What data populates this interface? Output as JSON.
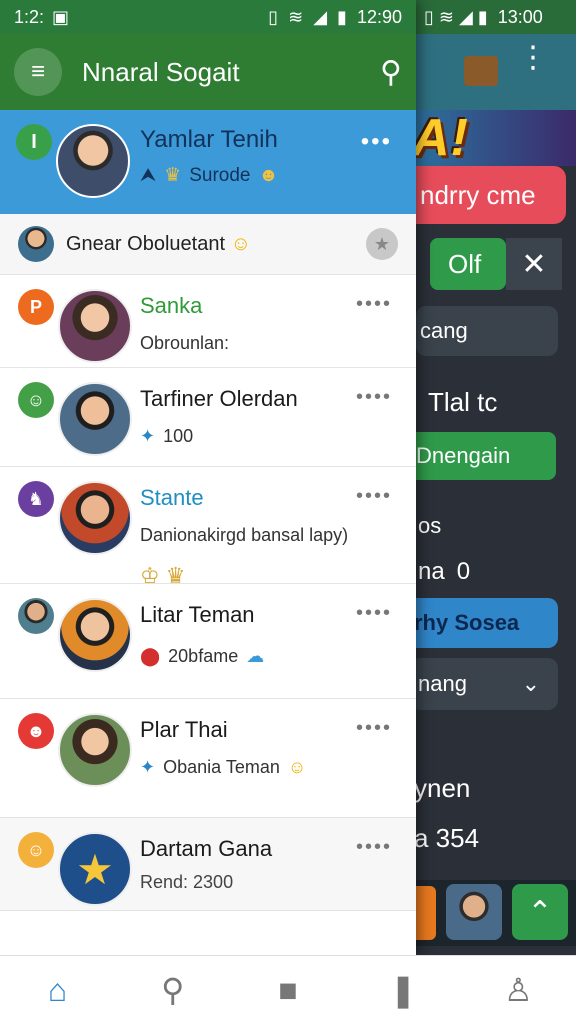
{
  "status_left": {
    "time": "1:2:"
  },
  "status_right": {
    "time": "12:90"
  },
  "status_far": {
    "time": "13:00"
  },
  "app_title": "Nnaral Sogait",
  "background": {
    "banner": "NDAICN TEA!",
    "items": [
      "ndrry cme",
      "Olf",
      "cang",
      "Tlal tc",
      "Dnengain",
      "os",
      "na",
      "0",
      "rhy Sosea",
      "nang",
      "ynen",
      "a 354"
    ]
  },
  "profile": {
    "name": "Yamlar Tenih",
    "subtitle": "Surode"
  },
  "account": {
    "label": "Gnear Oboluetant"
  },
  "chats": [
    {
      "name": "Sanka",
      "message": "Obrounlan:",
      "name_color": "#2f9a3a",
      "badge_color": "#ee6a1f"
    },
    {
      "name": "Tarfiner Olerdan",
      "message": "100",
      "name_color": "#1b1b1b",
      "badge_color": "#43a047"
    },
    {
      "name": "Stante",
      "message": "Danionakirgd bansal lapy)",
      "name_color": "#1f8fc2",
      "badge_color": "#6b3fa0"
    },
    {
      "name": "Litar Teman",
      "message": "20bfame",
      "name_color": "#1b1b1b",
      "badge_color": "#4f7f8e"
    },
    {
      "name": "Plar Thai",
      "message": "Obania Teman",
      "name_color": "#1b1b1b",
      "badge_color": "#e53935"
    },
    {
      "name": "Dartam Gana",
      "message": "Rend: 2300",
      "name_color": "#1b1b1b",
      "badge_color": "#f3b03a"
    }
  ],
  "icons": {
    "menu": "menu-icon",
    "search": "search-icon",
    "more": "more-icon",
    "home": "home-icon",
    "stop": "square-icon",
    "bookmark": "bookmark-icon",
    "profile": "profile-icon"
  },
  "colors": {
    "app_bar": "#2e7d32",
    "profile_header": "#3d9ad8",
    "nav_active": "#2e86d1"
  }
}
